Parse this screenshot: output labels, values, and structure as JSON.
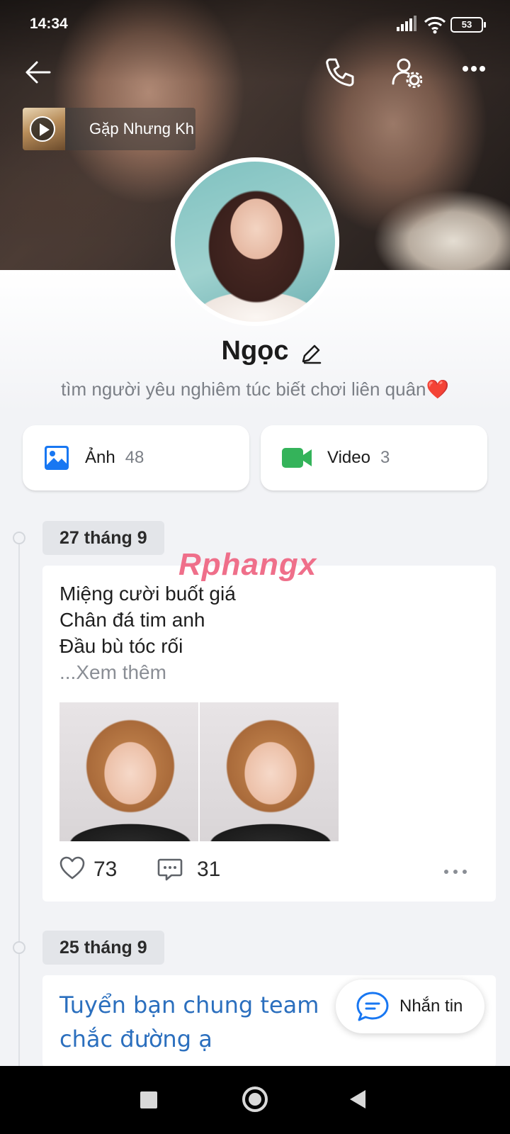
{
  "status_bar": {
    "time": "14:34",
    "battery": "53"
  },
  "music": {
    "title": "Gặp Nhưng Không Ở Lại"
  },
  "profile": {
    "name": "Ngọc",
    "bio": "tìm người yêu nghiêm túc biết chơi liên quân",
    "bio_emoji": "❤️"
  },
  "media": {
    "photos_label": "Ảnh",
    "photos_count": "48",
    "videos_label": "Video",
    "videos_count": "3"
  },
  "posts": [
    {
      "date": "27 tháng 9",
      "lines": [
        "Miệng cười buốt giá",
        "Chân đá tim anh",
        "Đầu bù tóc rối"
      ],
      "see_more": "...Xem thêm",
      "likes": "73",
      "comments": "31"
    },
    {
      "date": "25 tháng 9",
      "text": "Tuyển bạn chung team chắc đường ạ"
    }
  ],
  "watermark": "Rphangx",
  "message_button": "Nhắn tin",
  "colors": {
    "accent_blue": "#1877f2",
    "video_green": "#34b35a",
    "post_link_blue": "#2b6fbe"
  },
  "icons": [
    "back-icon",
    "phone-icon",
    "profile-settings-icon",
    "more-icon",
    "edit-icon",
    "photo-icon",
    "video-icon",
    "heart-icon",
    "comment-icon",
    "chat-icon"
  ]
}
